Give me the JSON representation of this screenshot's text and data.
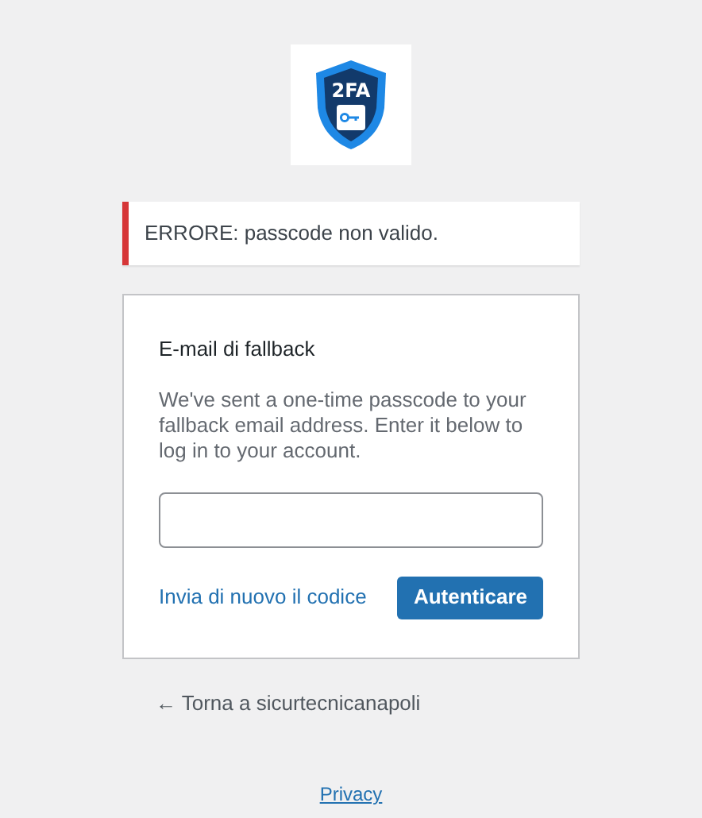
{
  "logo": {
    "text": "2FA"
  },
  "error": {
    "text": "ERRORE: passcode non valido."
  },
  "form": {
    "title": "E-mail di fallback",
    "message": "We've sent a one-time passcode to your fallback email address. Enter it below to log in to your account.",
    "resend_link": "Invia di nuovo il codice",
    "submit_button": "Autenticare"
  },
  "back_link": "← Torna a sicurtecnicanapoli",
  "privacy_link": "Privacy"
}
